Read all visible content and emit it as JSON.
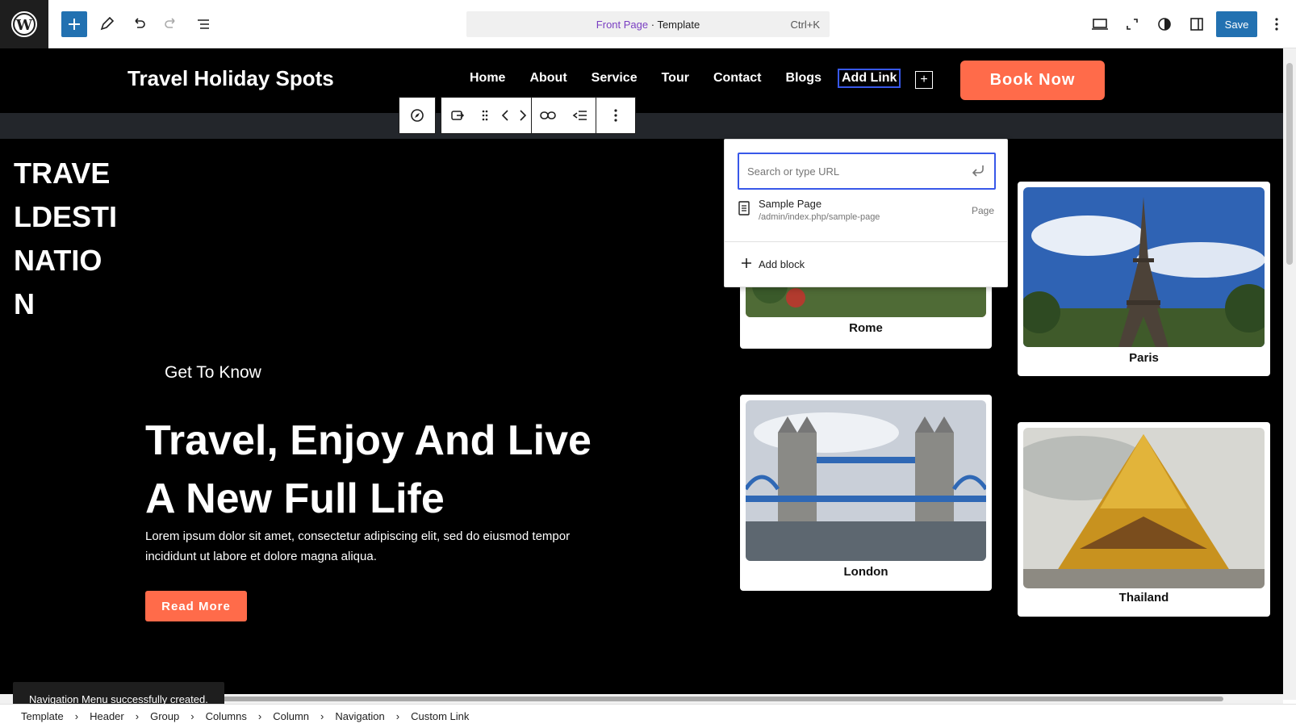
{
  "editor": {
    "command_center": {
      "page": "Front Page",
      "separator": " · ",
      "type": "Template",
      "shortcut": "Ctrl+K"
    },
    "save_label": "Save"
  },
  "site": {
    "title": "Travel Holiday Spots",
    "nav": [
      "Home",
      "About",
      "Service",
      "Tour",
      "Contact",
      "Blogs"
    ],
    "nav_add_link": "Add Link",
    "nav_plus": "+",
    "book_now": "Book Now"
  },
  "hero": {
    "vertical_text": "TRAVELDESTINATION",
    "eyebrow": "Get To Know",
    "headline": "Travel, Enjoy And Live A New Full Life",
    "body": "Lorem ipsum dolor sit amet, consectetur adipiscing elit, sed do eiusmod tempor incididunt ut labore et dolore magna aliqua.",
    "cta": "Read More"
  },
  "cards": [
    {
      "name": "Rome"
    },
    {
      "name": "Paris"
    },
    {
      "name": "London"
    },
    {
      "name": "Thailand"
    }
  ],
  "link_popover": {
    "placeholder": "Search or type URL",
    "result_title": "Sample Page",
    "result_url": "/admin/index.php/sample-page",
    "result_type": "Page",
    "add_block": "Add block"
  },
  "snackbar": "Navigation Menu successfully created.",
  "breadcrumb": [
    "Template",
    "Header",
    "Group",
    "Columns",
    "Column",
    "Navigation",
    "Custom Link"
  ],
  "colors": {
    "accent": "#2271b1",
    "brand_orange": "#ff6b4a",
    "focus_blue": "#3858e9",
    "canvas_bg": "#000000"
  }
}
